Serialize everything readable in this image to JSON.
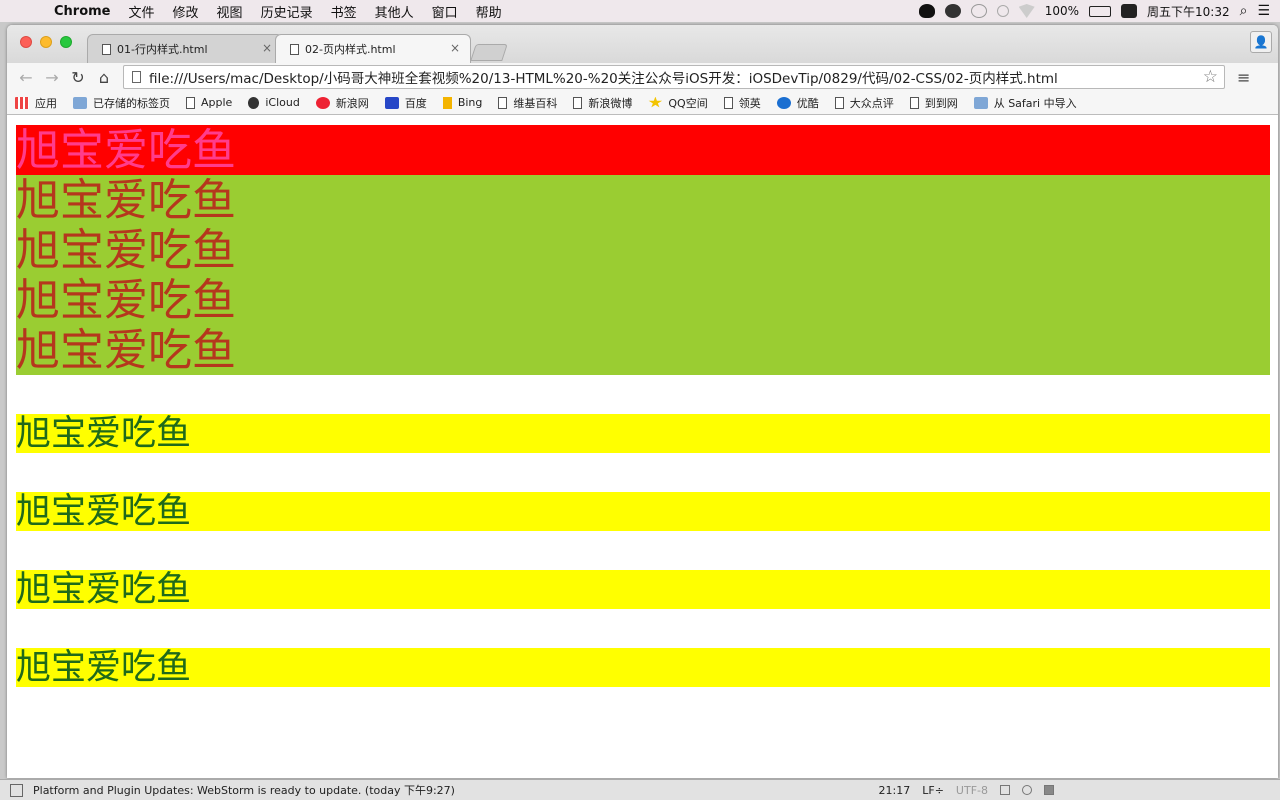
{
  "menubar": {
    "app": "Chrome",
    "items": [
      "文件",
      "修改",
      "视图",
      "历史记录",
      "书签",
      "其他人",
      "窗口",
      "帮助"
    ],
    "battery": "100%",
    "clock": "周五下午10:32"
  },
  "tabs": [
    {
      "title": "01-行内样式.html"
    },
    {
      "title": "02-页内样式.html"
    }
  ],
  "omnibox": {
    "url": "file:///Users/mac/Desktop/小码哥大神班全套视频%20/13-HTML%20-%20关注公众号iOS开发：iOSDevTip/0829/代码/02-CSS/02-页内样式.html"
  },
  "bookmarks": [
    {
      "label": "应用",
      "icon": "apps-icon"
    },
    {
      "label": "已存储的标签页",
      "icon": "folder-icon"
    },
    {
      "label": "Apple",
      "icon": "page-icon"
    },
    {
      "label": "iCloud",
      "icon": "apple-icon"
    },
    {
      "label": "新浪网",
      "icon": "weibo-icon"
    },
    {
      "label": "百度",
      "icon": "baidu-icon"
    },
    {
      "label": "Bing",
      "icon": "bing-icon"
    },
    {
      "label": "维基百科",
      "icon": "page-icon"
    },
    {
      "label": "新浪微博",
      "icon": "page-icon"
    },
    {
      "label": "QQ空间",
      "icon": "star-icon"
    },
    {
      "label": "领英",
      "icon": "page-icon"
    },
    {
      "label": "优酷",
      "icon": "youku-icon"
    },
    {
      "label": "大众点评",
      "icon": "page-icon"
    },
    {
      "label": "到到网",
      "icon": "page-icon"
    },
    {
      "label": "从 Safari 中导入",
      "icon": "folder-icon"
    }
  ],
  "page": {
    "red_block": "旭宝爱吃鱼",
    "green_blocks": [
      "旭宝爱吃鱼",
      "旭宝爱吃鱼",
      "旭宝爱吃鱼",
      "旭宝爱吃鱼"
    ],
    "yellow_blocks": [
      "旭宝爱吃鱼",
      "旭宝爱吃鱼",
      "旭宝爱吃鱼",
      "旭宝爱吃鱼"
    ],
    "colors": {
      "red": "#ff0000",
      "green": "#9acd32",
      "yellow": "#ffff00"
    }
  },
  "statusbar": {
    "message": "Platform and Plugin Updates: WebStorm is ready to update. (today 下午9:27)",
    "position": "21:17",
    "line_sep": "LF÷",
    "encoding": "UTF-8"
  }
}
